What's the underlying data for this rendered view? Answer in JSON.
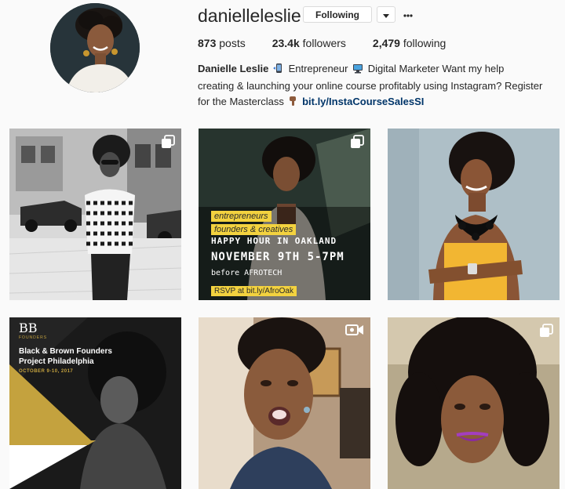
{
  "profile": {
    "username": "danielleleslie",
    "follow_label": "Following",
    "stats": {
      "posts_count": "873",
      "posts_label": "posts",
      "followers_count": "23.4k",
      "followers_label": "followers",
      "following_count": "2,479",
      "following_label": "following"
    },
    "bio": {
      "name": "Danielle Leslie",
      "line1": "Entrepreneur",
      "line2": "Digital Marketer Want my help creating & launching your online course profitably using Instagram? Register for the Masterclass",
      "link": "bit.ly/InstaCourseSalesSI"
    }
  },
  "posts": [
    {
      "type": "multi",
      "theme": "bw-street"
    },
    {
      "type": "multi",
      "theme": "promo",
      "tag1": "entrepreneurs",
      "tag2": "founders & creatives",
      "line1": "HAPPY HOUR IN OAKLAND",
      "line2": "NOVEMBER 9TH 5-7PM",
      "line3": "before AFROTECH",
      "rsvp": "RSVP at bit.ly/AfroOak"
    },
    {
      "type": "single",
      "theme": "yellow-dress"
    },
    {
      "type": "single",
      "theme": "bbf",
      "logo": "BB",
      "logo_sub": "FOUNDERS",
      "title1": "Black & Brown Founders",
      "title2": "Project Philadelphia",
      "dates": "OCTOBER 9-10, 2017"
    },
    {
      "type": "video",
      "theme": "selfie"
    },
    {
      "type": "multi",
      "theme": "purple-lips"
    }
  ],
  "colors": {
    "link": "#003569",
    "highlight": "#f3d23f",
    "border": "#dbdbdb"
  }
}
